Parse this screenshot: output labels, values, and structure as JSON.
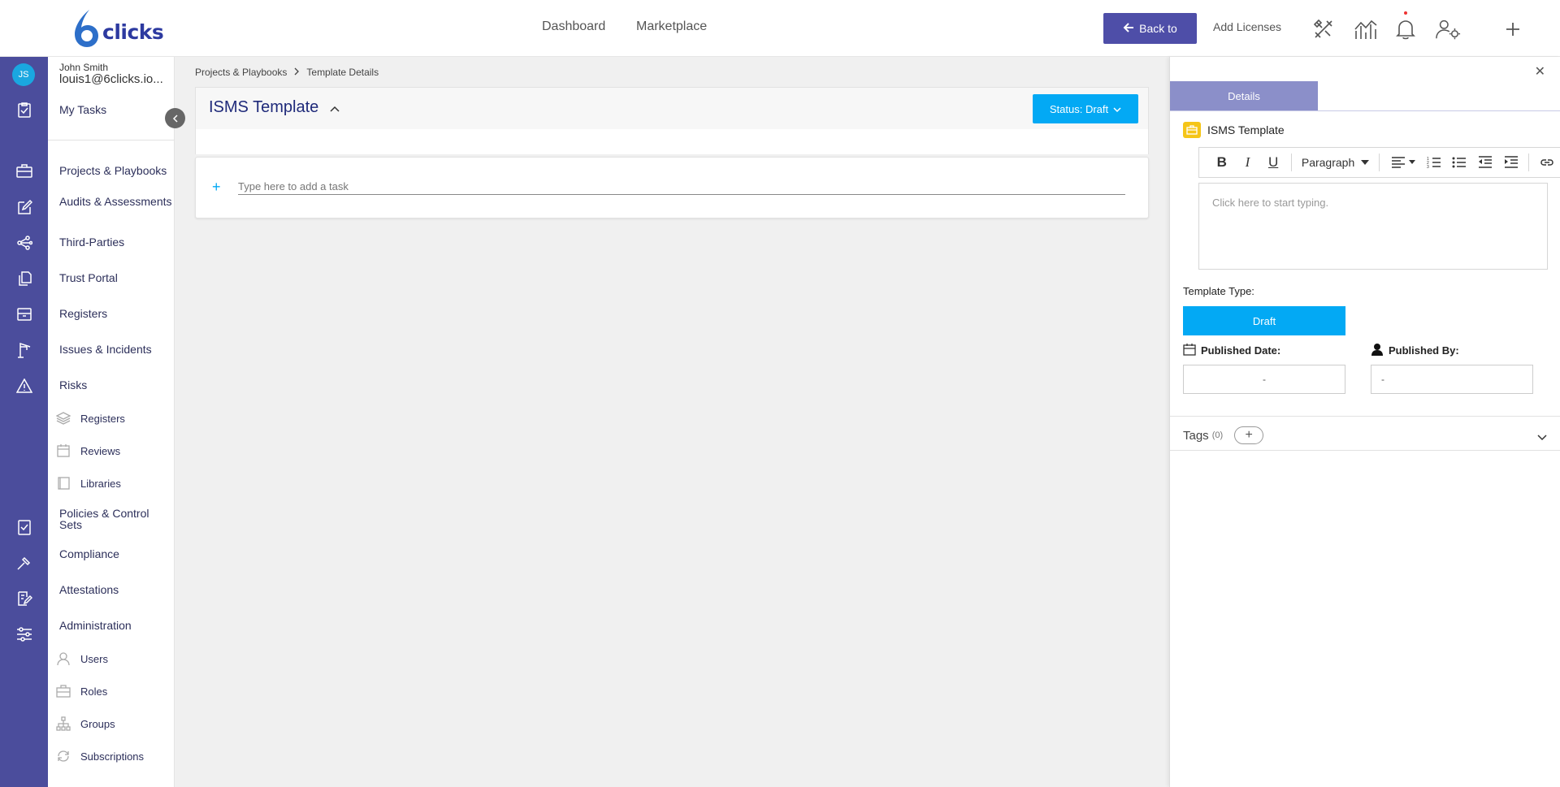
{
  "header": {
    "logo_text": "clicks",
    "nav": [
      "Dashboard",
      "Marketplace"
    ],
    "back_button": "Back to",
    "add_licenses": "Add Licenses",
    "icons": [
      "tools-icon",
      "analytics-icon",
      "bell-icon",
      "user-settings-icon",
      "plus-icon"
    ]
  },
  "user": {
    "initials": "JS",
    "name": "John Smith",
    "email": "louis1@6clicks.io..."
  },
  "sidebar": {
    "my_tasks": "My Tasks",
    "items": [
      {
        "label": "Projects & Playbooks"
      },
      {
        "label": "Audits & Assessments"
      },
      {
        "label": "Third-Parties"
      },
      {
        "label": "Trust Portal"
      },
      {
        "label": "Registers"
      },
      {
        "label": "Issues & Incidents"
      },
      {
        "label": "Risks"
      }
    ],
    "risk_sub": [
      "Registers",
      "Reviews",
      "Libraries"
    ],
    "items2": [
      {
        "label": "Policies & Control Sets"
      },
      {
        "label": "Compliance"
      },
      {
        "label": "Attestations"
      },
      {
        "label": "Administration"
      }
    ],
    "admin_sub": [
      "Users",
      "Roles",
      "Groups",
      "Subscriptions"
    ]
  },
  "breadcrumb": [
    "Projects & Playbooks",
    "Template Details"
  ],
  "template": {
    "title": "ISMS Template",
    "status_label": "Status: Draft"
  },
  "task_input": {
    "placeholder": "Type here to add a task"
  },
  "panel": {
    "tab": "Details",
    "title": "ISMS Template",
    "paragraph_select": "Paragraph",
    "editor_placeholder": "Click here to start typing.",
    "template_type_label": "Template Type:",
    "template_type_value": "Draft",
    "published_date_label": "Published Date:",
    "published_date_value": "-",
    "published_by_label": "Published By:",
    "published_by_value": "-",
    "tags_label": "Tags",
    "tags_count": "(0)"
  },
  "colors": {
    "brand": "#4b4d9c",
    "accent": "#03a9f4",
    "back_button": "#4e4ea8"
  }
}
